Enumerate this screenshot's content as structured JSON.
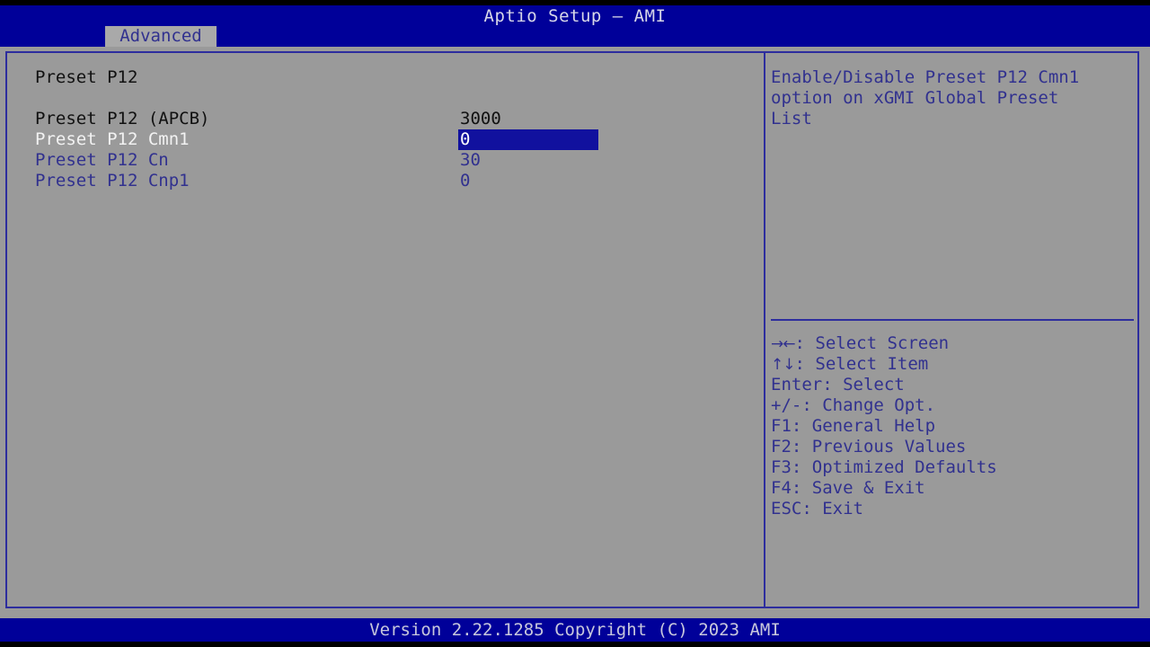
{
  "window": {
    "title": "Aptio Setup – AMI"
  },
  "menubar": {
    "tabs": [
      {
        "label": "Advanced",
        "active": true
      }
    ]
  },
  "settings_pane": {
    "section_title": "Preset P12",
    "rows": [
      {
        "label": "Preset P12 (APCB)",
        "value": "3000",
        "state": "disabled"
      },
      {
        "label": "Preset P12 Cmn1",
        "value": "0",
        "state": "selected"
      },
      {
        "label": "Preset P12 Cn",
        "value": "30",
        "state": "normal"
      },
      {
        "label": "Preset P12 Cnp1",
        "value": "0",
        "state": "normal"
      }
    ]
  },
  "help_pane": {
    "description_lines": [
      "Enable/Disable Preset P12 Cmn1",
      "option on xGMI Global Preset",
      "List"
    ],
    "key_legend": [
      {
        "glyph": "→←",
        "text": ": Select Screen"
      },
      {
        "glyph": "↑↓",
        "text": ": Select Item"
      },
      {
        "glyph": "",
        "text": "Enter: Select"
      },
      {
        "glyph": "",
        "text": "+/-: Change Opt."
      },
      {
        "glyph": "",
        "text": "F1: General Help"
      },
      {
        "glyph": "",
        "text": "F2: Previous Values"
      },
      {
        "glyph": "",
        "text": "F3: Optimized Defaults"
      },
      {
        "glyph": "",
        "text": "F4: Save & Exit"
      },
      {
        "glyph": "",
        "text": "ESC: Exit"
      }
    ]
  },
  "footer": {
    "version_text": "Version 2.22.1285 Copyright (C) 2023 AMI"
  },
  "colors": {
    "background": "#9a9a9a",
    "header_blue": "#000099",
    "border_blue": "#2d2d9e",
    "text_blue": "#31318f",
    "highlight_blue": "#11119e",
    "text_black": "#111111",
    "text_white": "#ffffff"
  }
}
